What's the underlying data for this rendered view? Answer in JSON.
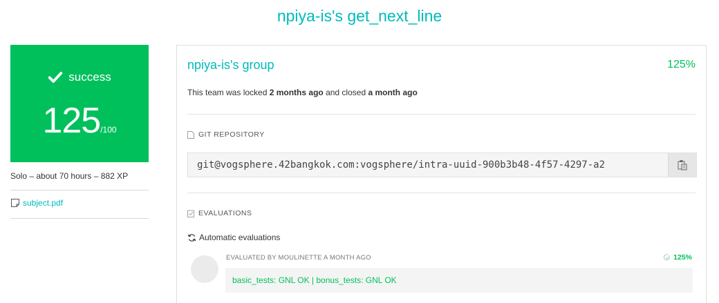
{
  "page": {
    "title": "npiya-is's get_next_line"
  },
  "score_card": {
    "status": "success",
    "score": "125",
    "max": "/100",
    "color": "#00c05c",
    "status_icon": "check-icon"
  },
  "project_meta": "Solo – about 70 hours – 882 XP",
  "subject": {
    "label": "subject.pdf",
    "icon": "document-icon"
  },
  "team": {
    "name": "npiya-is's group",
    "score": "125%",
    "lock_prefix": "This team was locked ",
    "locked_ago": "2 months ago",
    "lock_middle": " and closed ",
    "closed_ago": "a month ago"
  },
  "git": {
    "label": "GIT REPOSITORY",
    "url": "git@vogsphere.42bangkok.com:vogsphere/intra-uuid-900b3b48-4f57-4297-a2",
    "icon": "clipboard-icon"
  },
  "evaluations": {
    "label": "EVALUATIONS",
    "automatic_label": "Automatic evaluations",
    "entries": [
      {
        "header": "EVALUATED BY MOULINETTE A MONTH AGO",
        "score": "125%",
        "result": "basic_tests: GNL OK | bonus_tests: GNL OK"
      }
    ]
  },
  "colors": {
    "accent": "#00babc",
    "success": "#00c05c"
  }
}
